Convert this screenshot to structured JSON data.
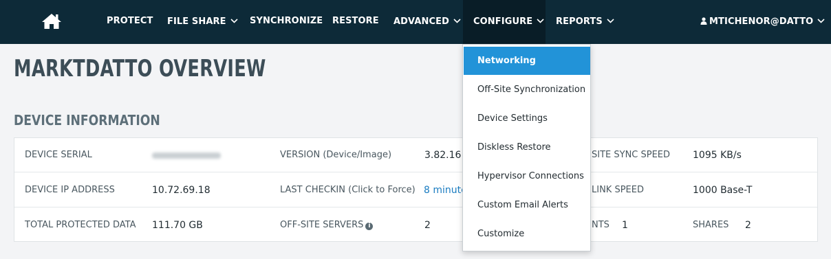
{
  "nav": {
    "home_icon": "home-icon",
    "items": [
      {
        "label": "PROTECT",
        "has_dropdown": false
      },
      {
        "label": "FILE SHARE",
        "has_dropdown": true
      },
      {
        "label": "SYNCHRONIZE",
        "has_dropdown": false
      },
      {
        "label": "RESTORE",
        "has_dropdown": false
      },
      {
        "label": "ADVANCED",
        "has_dropdown": true
      },
      {
        "label": "CONFIGURE",
        "has_dropdown": true,
        "active": true
      },
      {
        "label": "REPORTS",
        "has_dropdown": true
      }
    ],
    "user": {
      "icon": "user-icon",
      "label": "MTICHENOR@DATTO"
    }
  },
  "page": {
    "title": "MARKTDATTO OVERVIEW",
    "section_title": "DEVICE INFORMATION"
  },
  "device_info": {
    "serial_label": "DEVICE SERIAL",
    "version_label": "VERSION (Device/Image)",
    "version_value": "3.82.16 /",
    "sync_speed_label": "SITE SYNC SPEED",
    "sync_speed_value": "1095 KB/s",
    "ip_label": "DEVICE IP ADDRESS",
    "ip_value": "10.72.69.18",
    "checkin_label": "LAST CHECKIN (Click to Force)",
    "checkin_value": "8 minute",
    "link_speed_label": "LINK SPEED",
    "link_speed_value": "1000 Base-T",
    "protected_label": "TOTAL PROTECTED DATA",
    "protected_value": "111.70 GB",
    "offsite_servers_label": "OFF-SITE SERVERS",
    "offsite_servers_value": "2",
    "nts_label": "NTS",
    "nts_value": "1",
    "shares_label": "SHARES",
    "shares_value": "2"
  },
  "configure_menu": {
    "items": [
      "Networking",
      "Off-Site Synchronization",
      "Device Settings",
      "Diskless Restore",
      "Hypervisor Connections",
      "Custom Email Alerts",
      "Customize"
    ],
    "highlighted": "Networking"
  },
  "colors": {
    "nav_bg": "#0d2a38",
    "active_nav_bg": "#091d27",
    "menu_highlight": "#2293d8",
    "link": "#1a7cc1"
  }
}
